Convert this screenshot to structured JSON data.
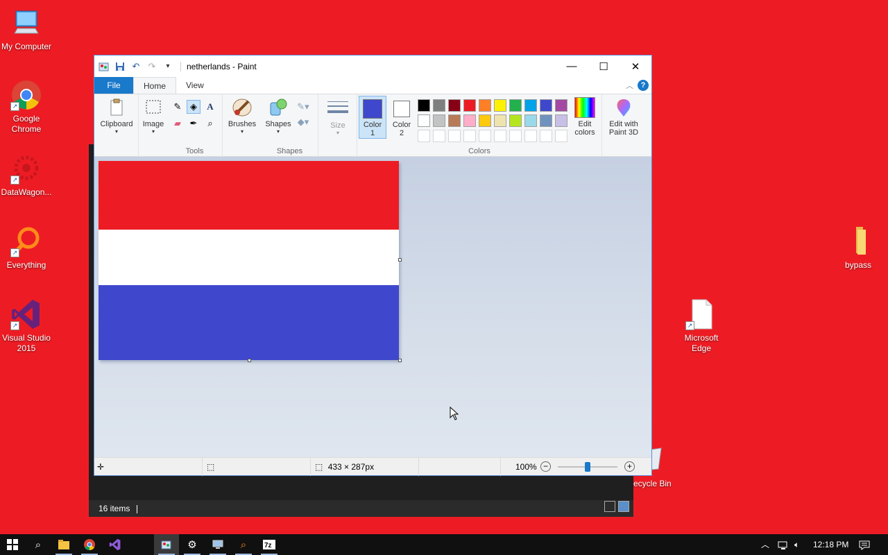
{
  "desktop": {
    "icons": [
      {
        "label": "My Computer",
        "icon": "computer-icon"
      },
      {
        "label": "Google Chrome",
        "icon": "chrome-icon"
      },
      {
        "label": "DataWagon...",
        "icon": "datawagon-icon"
      },
      {
        "label": "Everything",
        "icon": "search-magnifier-icon"
      },
      {
        "label": "Visual Studio 2015",
        "icon": "visual-studio-icon"
      },
      {
        "label": "bypass",
        "icon": "folder-icon"
      },
      {
        "label": "Microsoft Edge",
        "icon": "file-icon"
      },
      {
        "label": "Recycle Bin",
        "icon": "recycle-bin-icon"
      }
    ]
  },
  "explorer": {
    "status_items": "16 items"
  },
  "paint": {
    "title": "netherlands - Paint",
    "tabs": {
      "file": "File",
      "home": "Home",
      "view": "View"
    },
    "ribbon": {
      "clipboard": "Clipboard",
      "image": "Image",
      "tools": "Tools",
      "brushes": "Brushes",
      "shapes_btn": "Shapes",
      "shapes_group": "Shapes",
      "size": "Size",
      "color1_a": "Color",
      "color1_b": "1",
      "color2_a": "Color",
      "color2_b": "2",
      "edit_colors_a": "Edit",
      "edit_colors_b": "colors",
      "paint3d_a": "Edit with",
      "paint3d_b": "Paint 3D",
      "colors_group": "Colors",
      "color1_value": "#3f48cc",
      "color2_value": "#ffffff",
      "palette_row1": [
        "#000000",
        "#7f7f7f",
        "#880015",
        "#ed1c24",
        "#ff7f27",
        "#fff200",
        "#22b14c",
        "#00a2e8",
        "#3f48cc",
        "#a349a4"
      ],
      "palette_row2": [
        "#ffffff",
        "#c3c3c3",
        "#b97a57",
        "#ffaec9",
        "#ffc90e",
        "#efe4b0",
        "#b5e61d",
        "#99d9ea",
        "#7092be",
        "#c8bfe7"
      ]
    },
    "canvas": {
      "bands": [
        "#ed1c24",
        "#ffffff",
        "#3f48cc"
      ],
      "band_fractions": [
        0.345,
        0.28,
        0.375
      ]
    },
    "status": {
      "dimensions": "433 × 287px",
      "zoom": "100%"
    }
  },
  "taskbar": {
    "time": "12:18 PM",
    "items": [
      "windows-start-icon",
      "search-icon",
      "file-explorer-icon",
      "chrome-icon",
      "visual-studio-icon",
      "paint-icon",
      "settings-gear-icon",
      "network-drive-icon",
      "everything-icon",
      "7zip-icon"
    ]
  }
}
